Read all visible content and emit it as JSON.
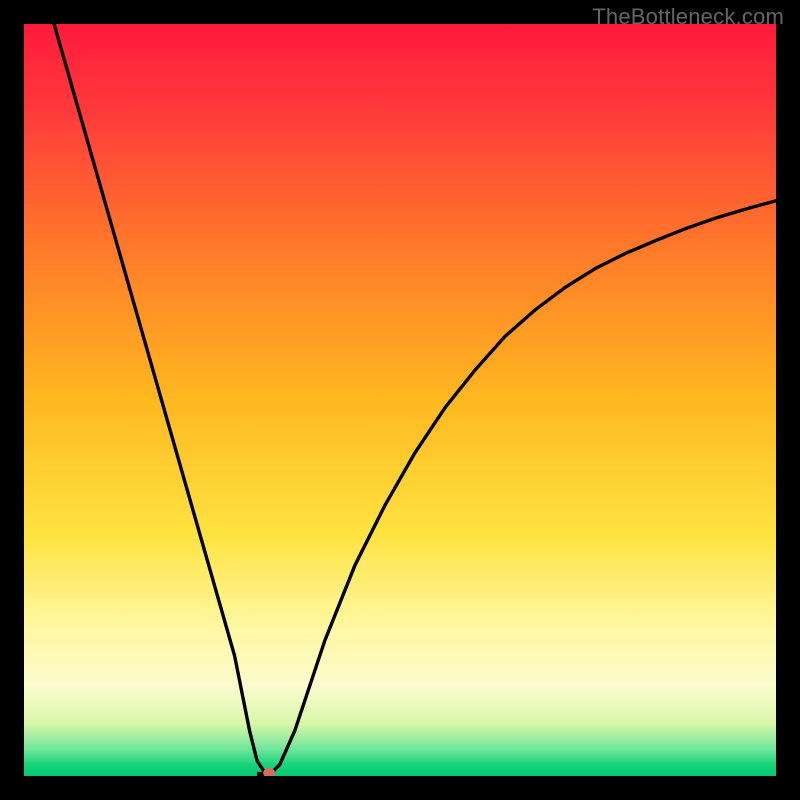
{
  "watermark": "TheBottleneck.com",
  "chart_data": {
    "type": "line",
    "title": "",
    "xlabel": "",
    "ylabel": "",
    "xlim": [
      0,
      100
    ],
    "ylim": [
      0,
      100
    ],
    "gradient_stops": [
      {
        "offset": 0.0,
        "color": "#ff1a3c"
      },
      {
        "offset": 0.12,
        "color": "#ff3b3b"
      },
      {
        "offset": 0.3,
        "color": "#ff7a2a"
      },
      {
        "offset": 0.5,
        "color": "#ffb820"
      },
      {
        "offset": 0.68,
        "color": "#ffe341"
      },
      {
        "offset": 0.8,
        "color": "#fff7a0"
      },
      {
        "offset": 0.88,
        "color": "#fcfccf"
      },
      {
        "offset": 0.93,
        "color": "#d8f7a8"
      },
      {
        "offset": 0.965,
        "color": "#6de59a"
      },
      {
        "offset": 0.985,
        "color": "#18d37b"
      },
      {
        "offset": 1.0,
        "color": "#00c86f"
      }
    ],
    "series": [
      {
        "name": "bottleneck-curve",
        "x": [
          4,
          6,
          8,
          10,
          12,
          14,
          16,
          18,
          20,
          22,
          24,
          26,
          28,
          30,
          31,
          32,
          33,
          34,
          36,
          38,
          40,
          44,
          48,
          52,
          56,
          60,
          64,
          68,
          72,
          76,
          80,
          84,
          88,
          92,
          96,
          100
        ],
        "y": [
          100,
          93,
          86,
          79,
          72,
          65,
          58,
          51,
          44,
          37,
          30,
          23,
          16,
          6,
          2,
          0.5,
          0.5,
          1.5,
          6,
          12,
          18,
          28,
          36,
          43,
          49,
          54,
          58.5,
          62,
          65,
          67.5,
          69.5,
          71.2,
          72.8,
          74.2,
          75.4,
          76.5
        ]
      }
    ],
    "marker": {
      "x": 32.6,
      "y": 0.4,
      "color": "#d66b5f",
      "r": 6
    },
    "min_bar": {
      "x0": 31,
      "x1": 33.2,
      "y": 0.3
    }
  }
}
